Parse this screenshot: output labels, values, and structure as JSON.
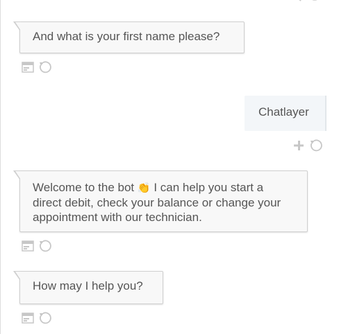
{
  "messages": [
    {
      "sender": "bot",
      "text": "And what is your first name please?"
    },
    {
      "sender": "user",
      "text": "Chatlayer"
    },
    {
      "sender": "bot",
      "text_before": "Welcome to the bot",
      "emoji": "👏",
      "text_after": "I can help you start a direct debit, check your balance or change your appointment with our technician."
    },
    {
      "sender": "bot",
      "text": "How may I help you?"
    }
  ],
  "actions": {
    "bot": [
      "card-icon",
      "restart-icon"
    ],
    "user": [
      "plus-icon",
      "restart-icon"
    ]
  },
  "colors": {
    "icon": "#c7c7c7",
    "bubble_border": "#cfcfcf",
    "bubble_bg": "#f8f8f8",
    "user_bg": "#f3f6f9"
  }
}
